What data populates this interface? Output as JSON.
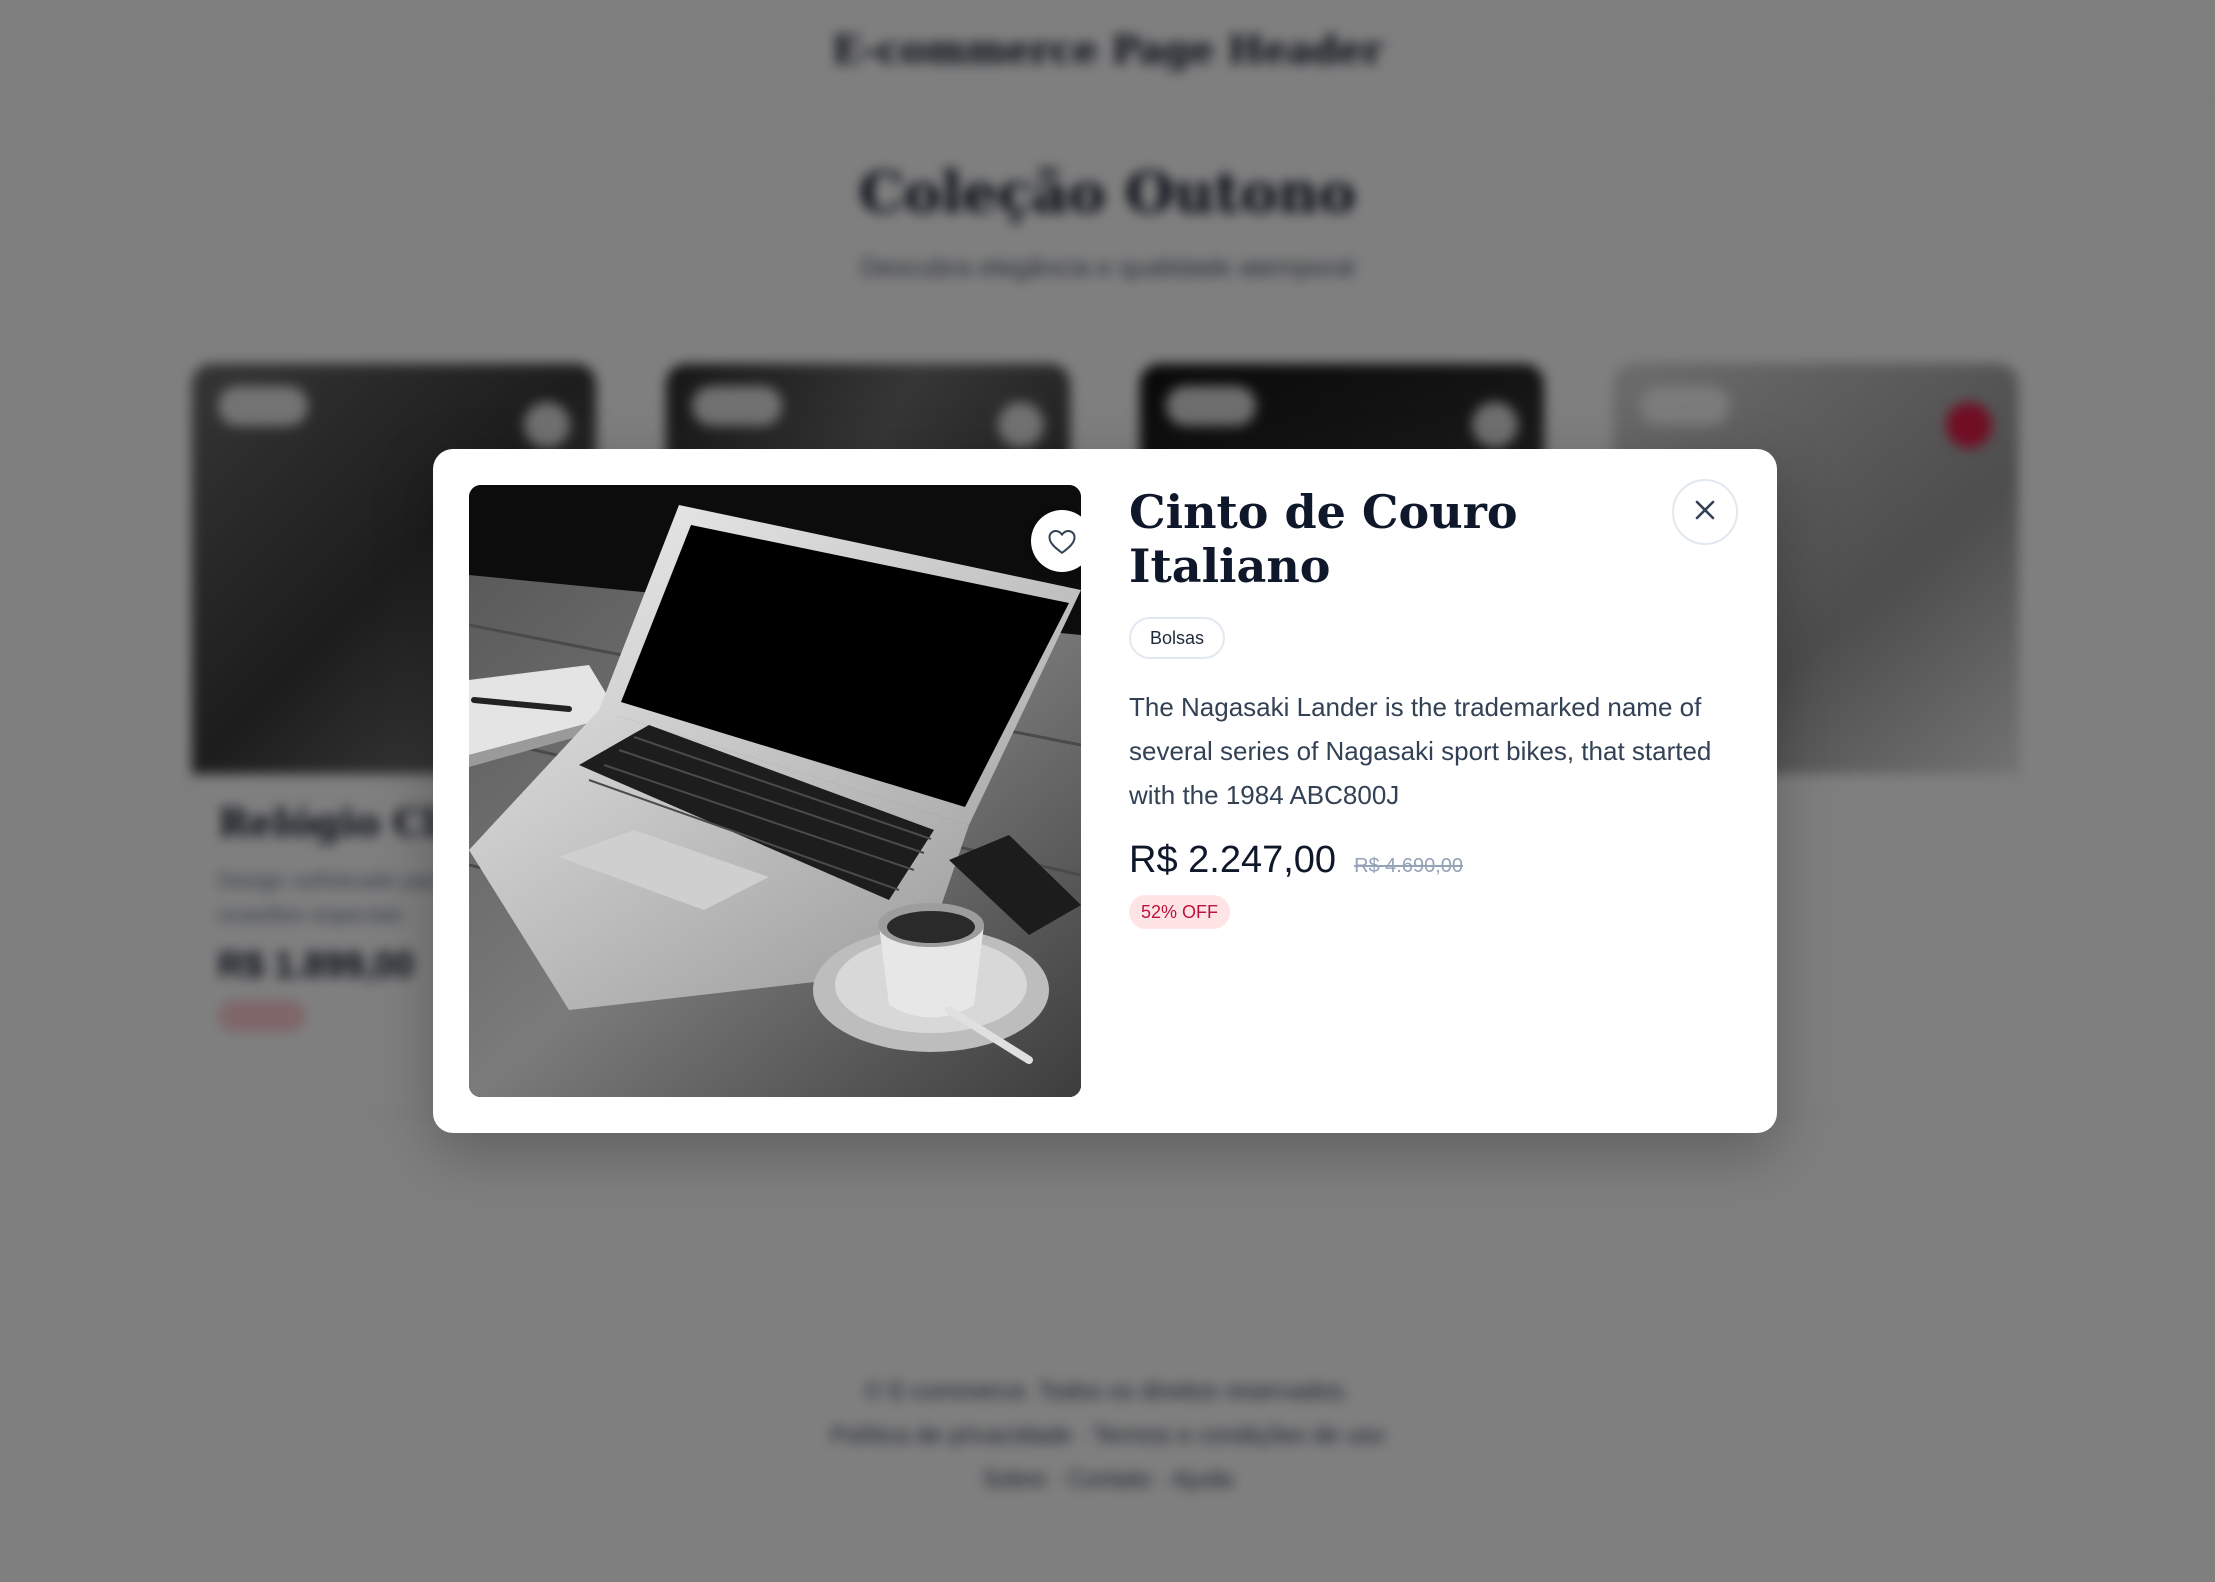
{
  "background_page": {
    "header_title": "E-commerce Page Header",
    "hero_title": "Coleção Outono",
    "hero_subtitle": "Descubra elegância e qualidade atemporal",
    "cards": [
      {
        "title": "Relógio Clássico",
        "description": "Design sofisticado para todas as ocasiões especiais",
        "price": "R$ 1.899,00"
      },
      {
        "title": "",
        "description": "",
        "price": ""
      },
      {
        "title": "",
        "description": "",
        "price": ""
      },
      {
        "title": "",
        "description": "",
        "price": ""
      }
    ],
    "footer_lines": [
      "© E-commerce. Todos os direitos reservados.",
      "Política de privacidade · Termos e condições de uso",
      "Sobre · Contato · Ajuda"
    ]
  },
  "modal": {
    "title": "Cinto de Couro Italiano",
    "category": "Bolsas",
    "description": "The Nagasaki Lander is the trademarked name of several series of Nagasaki sport bikes, that started with the 1984 ABC800J",
    "price": "R$ 2.247,00",
    "original_price": "R$ 4.690,00",
    "discount": "52% OFF",
    "icons": {
      "favorite": "heart-icon",
      "close": "close-icon"
    },
    "colors": {
      "overlay": "#000000",
      "discount_bg": "#ffe4e6",
      "discount_text": "#be123c",
      "title": "#0f172a"
    }
  }
}
